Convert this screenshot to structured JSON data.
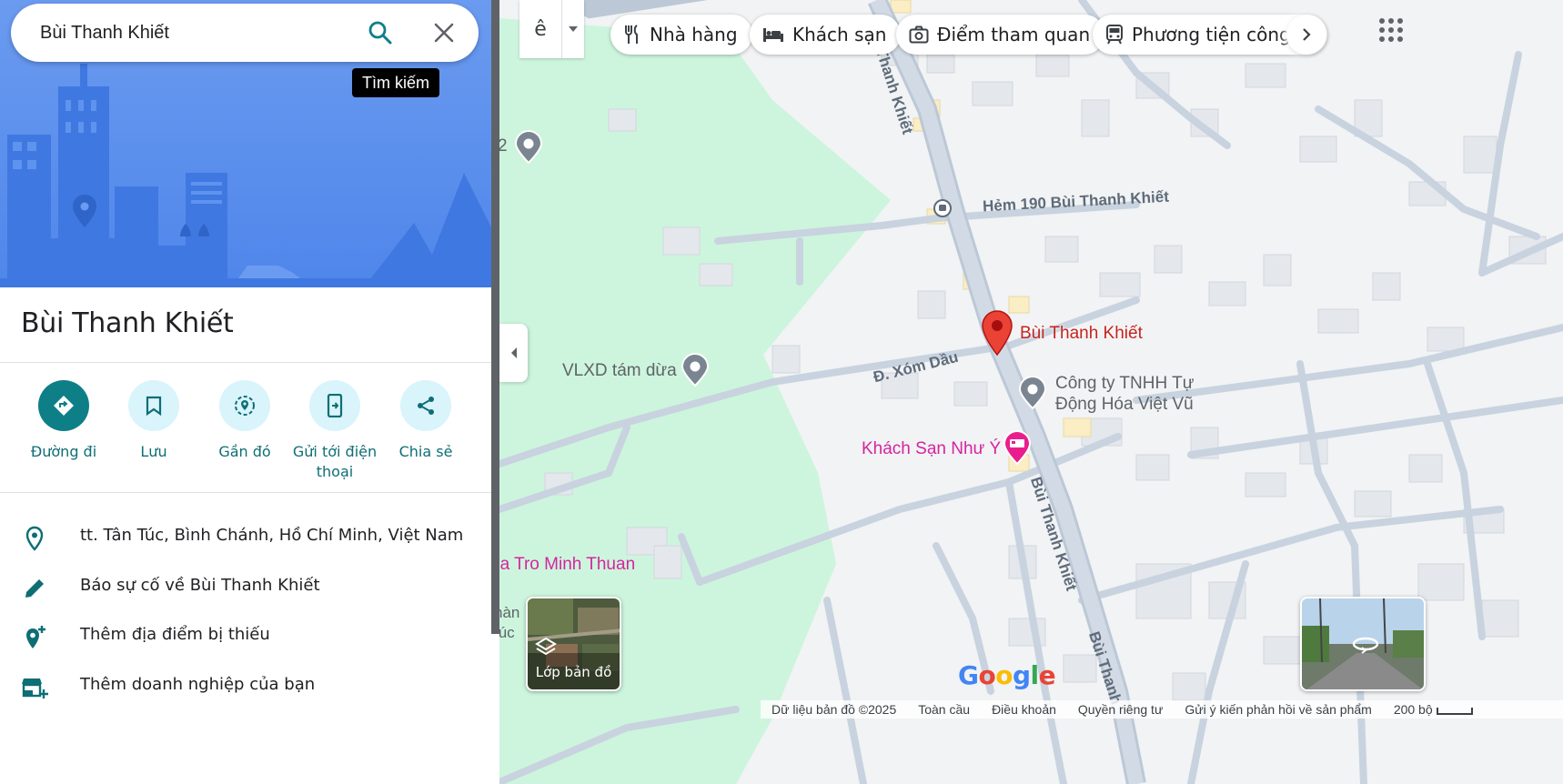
{
  "search": {
    "value": "Bùi Thanh Khiết",
    "tooltip": "Tìm kiếm"
  },
  "place": {
    "title": "Bùi Thanh Khiết"
  },
  "actions": [
    {
      "label": "Đường đi",
      "icon": "directions-icon"
    },
    {
      "label": "Lưu",
      "icon": "bookmark-icon"
    },
    {
      "label": "Gần đó",
      "icon": "nearby-icon"
    },
    {
      "label": "Gửi tới điện thoại",
      "icon": "send-to-phone-icon"
    },
    {
      "label": "Chia sẻ",
      "icon": "share-icon"
    }
  ],
  "info_rows": [
    {
      "text": "tt. Tân Túc, Bình Chánh, Hồ Chí Minh, Việt Nam",
      "icon": "location-pin-icon"
    },
    {
      "text": "Báo sự cố về Bùi Thanh Khiết",
      "icon": "edit-pencil-icon"
    },
    {
      "text": "Thêm địa điểm bị thiếu",
      "icon": "add-place-icon"
    },
    {
      "text": "Thêm doanh nghiệp của bạn",
      "icon": "add-business-icon"
    }
  ],
  "chips": [
    {
      "label": "Nhà hàng",
      "icon": "restaurant-icon"
    },
    {
      "label": "Khách sạn",
      "icon": "hotel-icon"
    },
    {
      "label": "Điểm tham quan",
      "icon": "camera-icon"
    },
    {
      "label": "Phương tiện công c",
      "icon": "transit-icon"
    }
  ],
  "map": {
    "layer_toggle_glyph": "ê",
    "labels": {
      "selected_place": "Bùi Thanh Khiết",
      "vlxd": "VLXD tám dừa",
      "company_line1": "Công ty TNHH Tự",
      "company_line2": "Động Hóa Việt Vũ",
      "hotel": "Khách Sạn Như Ý",
      "nha_tro": "ha Tro Minh Thuan",
      "hem190": "Hẻm 190 Bùi Thanh Khiết",
      "xom_dau": "Đ. Xóm Dầu",
      "bui_road_top": "Bùi Thanh Khiết",
      "bui_road_mid": "Bùi Thanh Khiết",
      "bui_road_bottom": "Bùi Thanh",
      "edge_num": "2",
      "edge_hang": "hàn",
      "edge_tuc": "túc"
    },
    "layers_button_label": "Lớp bản đồ",
    "logo": "Google"
  },
  "footer": {
    "items": [
      "Dữ liệu bản đồ ©2025",
      "Toàn cầu",
      "Điều khoản",
      "Quyền riêng tư",
      "Gửi ý kiến phản hồi về sản phẩm",
      "200 bộ"
    ]
  },
  "colors": {
    "accent": "#0e7f87",
    "pin": "#ea4335",
    "park": "#cdf5dd",
    "road": "#c8d3df"
  }
}
